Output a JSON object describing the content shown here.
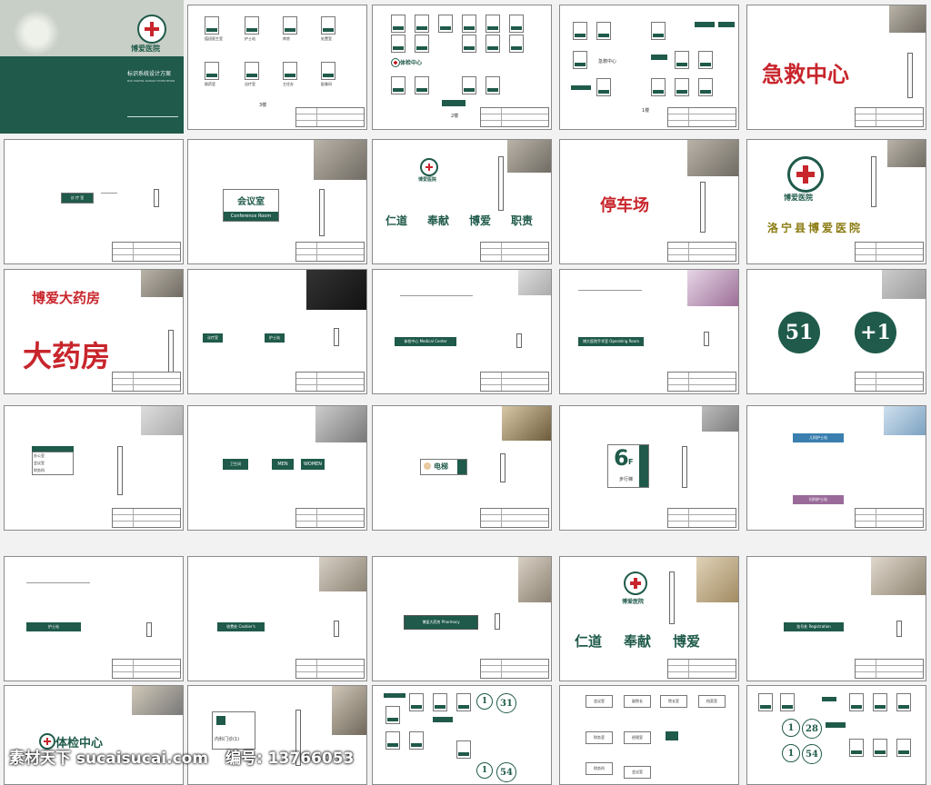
{
  "cover": {
    "title": "博爱医院",
    "subtitle": "标识系统设计方案",
    "small_line": "BOAI HOSPITAL SIGNAGE SYSTEM DESIGN"
  },
  "sheet2": {
    "floor": "3楼",
    "labels": [
      "值班医生室",
      "护士站",
      "库房",
      "处置室",
      "换药室",
      "治疗室",
      "主任办",
      "配餐间"
    ]
  },
  "sheet3": {
    "brand": "体检中心",
    "floor": "2楼"
  },
  "sheet4": {
    "floor": "1楼",
    "label": "急救中心"
  },
  "sheet5": {
    "headline": "急救中心"
  },
  "sheet6": {
    "sign": "诊 疗 室"
  },
  "sheet7": {
    "cn": "会议室",
    "en": "Conference Room"
  },
  "sheet8": {
    "name": "博爱医院",
    "values": [
      "仁道",
      "奉献",
      "博爱",
      "职责"
    ]
  },
  "sheet9": {
    "text": "停车场"
  },
  "sheet10": {
    "name": "博爱医院",
    "full": "洛宁县博爱医院"
  },
  "sheet11": {
    "line1": "博爱大药房",
    "line2": "大药房"
  },
  "sheet12": {
    "left": "诊疗室",
    "right": "护士站"
  },
  "sheet13": {
    "sign": "体检中心 Medical Center"
  },
  "sheet14": {
    "sign": "博大医院手术室 Operating Room"
  },
  "sheet15": {
    "n1": "51",
    "n2": "+1"
  },
  "sheet16": {
    "rows": [
      "办公室",
      "会议室",
      "财务科"
    ]
  },
  "sheet17": {
    "a": "卫生间",
    "men": "MEN",
    "women": "WOMEN"
  },
  "sheet18": {
    "text": "电梯"
  },
  "sheet19": {
    "floor": "6",
    "unit": "F",
    "sub": "步行梯"
  },
  "sheet20": {
    "top": "儿科护士站",
    "bottom": "妇科护士站"
  },
  "sheet21": {
    "sign": "护士站"
  },
  "sheet22": {
    "sign": "收费处 Cashier's"
  },
  "sheet23": {
    "sign": "博爱大药房 Pharmacy"
  },
  "sheet24": {
    "name": "博爱医院",
    "values": [
      "仁道",
      "奉献",
      "博爱"
    ]
  },
  "sheet25": {
    "sign": "挂号处 Registration"
  },
  "sheet26": {
    "brand": "体检中心"
  },
  "sheet27": {
    "room": "内科门诊(1)"
  },
  "sheet28": {
    "n1": "1",
    "n2": "31",
    "n3": "1",
    "n4": "54"
  },
  "sheet29": {
    "rooms": [
      "会议室",
      "副院长",
      "院长室",
      "档案室",
      "财务室",
      "经理室",
      "财务科",
      "会议室"
    ]
  },
  "sheet30": {
    "n1": "1",
    "n2": "28",
    "n3": "1",
    "n4": "54"
  },
  "watermark": {
    "left": "素材天下 sucaisucai.com",
    "right": "编号: 13766053"
  },
  "colors": {
    "brand_green": "#1f5a4a",
    "brand_red": "#c8252c"
  }
}
